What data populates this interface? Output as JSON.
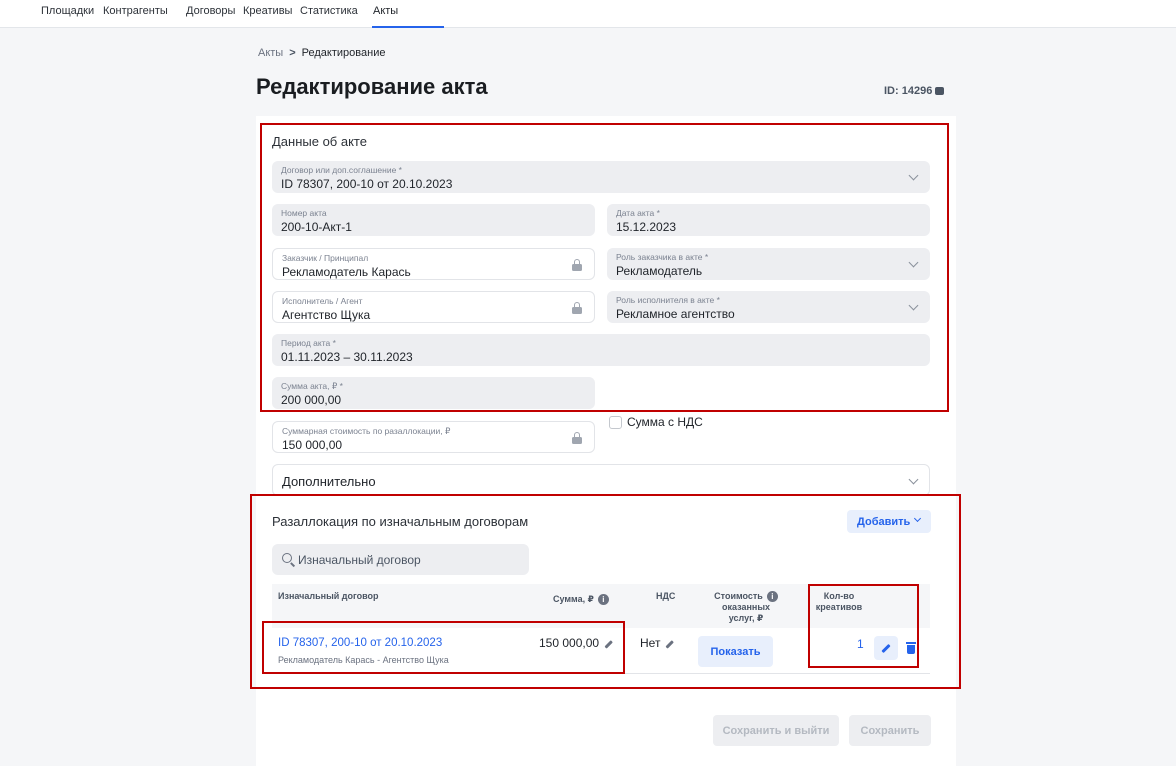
{
  "nav": {
    "items": [
      "Площадки",
      "Контрагенты",
      "Договоры",
      "Креативы",
      "Статистика",
      "Акты"
    ],
    "active": "Акты"
  },
  "breadcrumb": {
    "parent": "Акты",
    "separator": ">",
    "current": "Редактирование"
  },
  "page": {
    "title": "Редактирование акта",
    "id_label": "ID: 14296"
  },
  "act_data": {
    "title": "Данные об акте",
    "contract": {
      "label": "Договор или доп.соглашение *",
      "value": "ID 78307, 200-10 от 20.10.2023"
    },
    "act_number": {
      "label": "Номер акта",
      "value": "200-10-Акт-1"
    },
    "act_date": {
      "label": "Дата акта *",
      "value": "15.12.2023"
    },
    "customer": {
      "label": "Заказчик / Принципал",
      "value": "Рекламодатель Карась"
    },
    "customer_role": {
      "label": "Роль заказчика в акте *",
      "value": "Рекламодатель"
    },
    "executor": {
      "label": "Исполнитель / Агент",
      "value": "Агентство Щука"
    },
    "executor_role": {
      "label": "Роль исполнителя в акте *",
      "value": "Рекламное агентство"
    },
    "period": {
      "label": "Период акта *",
      "value": "01.11.2023 – 30.11.2023"
    },
    "amount": {
      "label": "Сумма акта, ₽ *",
      "value": "200 000,00"
    },
    "vat_checkbox": {
      "label": "Сумма с НДС",
      "checked": false
    },
    "reallocation_total": {
      "label": "Суммарная стоимость по разаллокации, ₽",
      "value": "150 000,00"
    }
  },
  "additional": {
    "label": "Дополнительно"
  },
  "reallocation": {
    "title": "Разаллокация по изначальным договорам",
    "add_label": "Добавить",
    "search_placeholder": "Изначальный договор",
    "columns": {
      "contract": "Изначальный договор",
      "sum": "Сумма, ₽",
      "vat": "НДС",
      "cost_line1": "Стоимость",
      "cost_line2": "оказанных",
      "cost_line3": "услуг, ₽",
      "creatives_line1": "Кол-во",
      "creatives_line2": "креативов"
    },
    "row": {
      "contract": "ID 78307, 200-10 от 20.10.2023",
      "parties": "Рекламодатель Карась - Агентство Щука",
      "sum": "150 000,00",
      "vat": "Нет",
      "show_label": "Показать",
      "creatives": "1"
    }
  },
  "footer": {
    "save_exit": "Сохранить и выйти",
    "save": "Сохранить"
  },
  "colors": {
    "accent": "#2563eb",
    "highlight": "#c00000"
  }
}
